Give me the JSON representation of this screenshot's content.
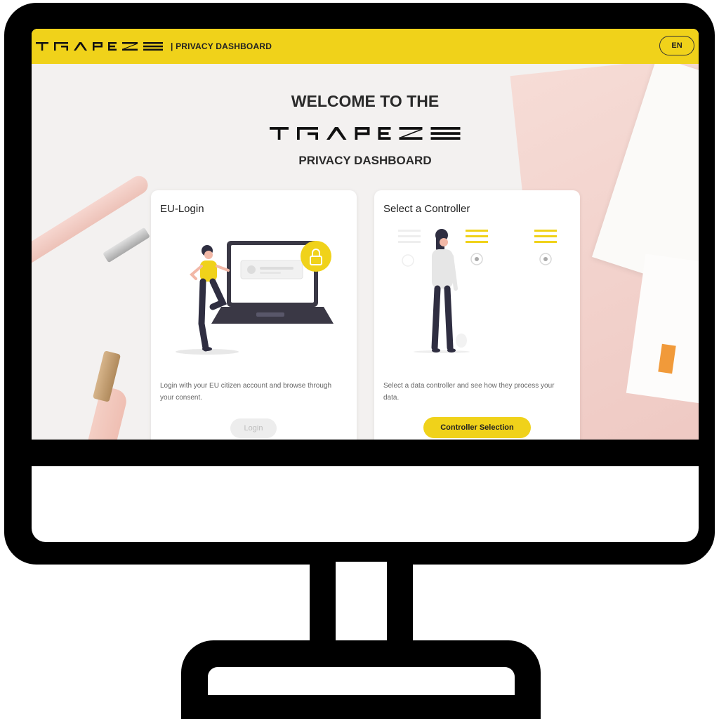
{
  "header": {
    "brand": "TRAPEZE",
    "section_label": "| PRIVACY DASHBOARD",
    "lang_label": "EN"
  },
  "welcome": {
    "title": "WELCOME TO THE",
    "subtitle": "PRIVACY DASHBOARD"
  },
  "cards": {
    "login": {
      "title": "EU-Login",
      "description": "Login with your EU citizen account and browse through your consent.",
      "button_label": "Login"
    },
    "controller": {
      "title": "Select a Controller",
      "description": "Select a data controller and see how they process your data.",
      "button_label": "Controller Selection"
    }
  },
  "colors": {
    "accent": "#f0d21a",
    "frame": "#000000",
    "text_dark": "#2a2a2a"
  }
}
